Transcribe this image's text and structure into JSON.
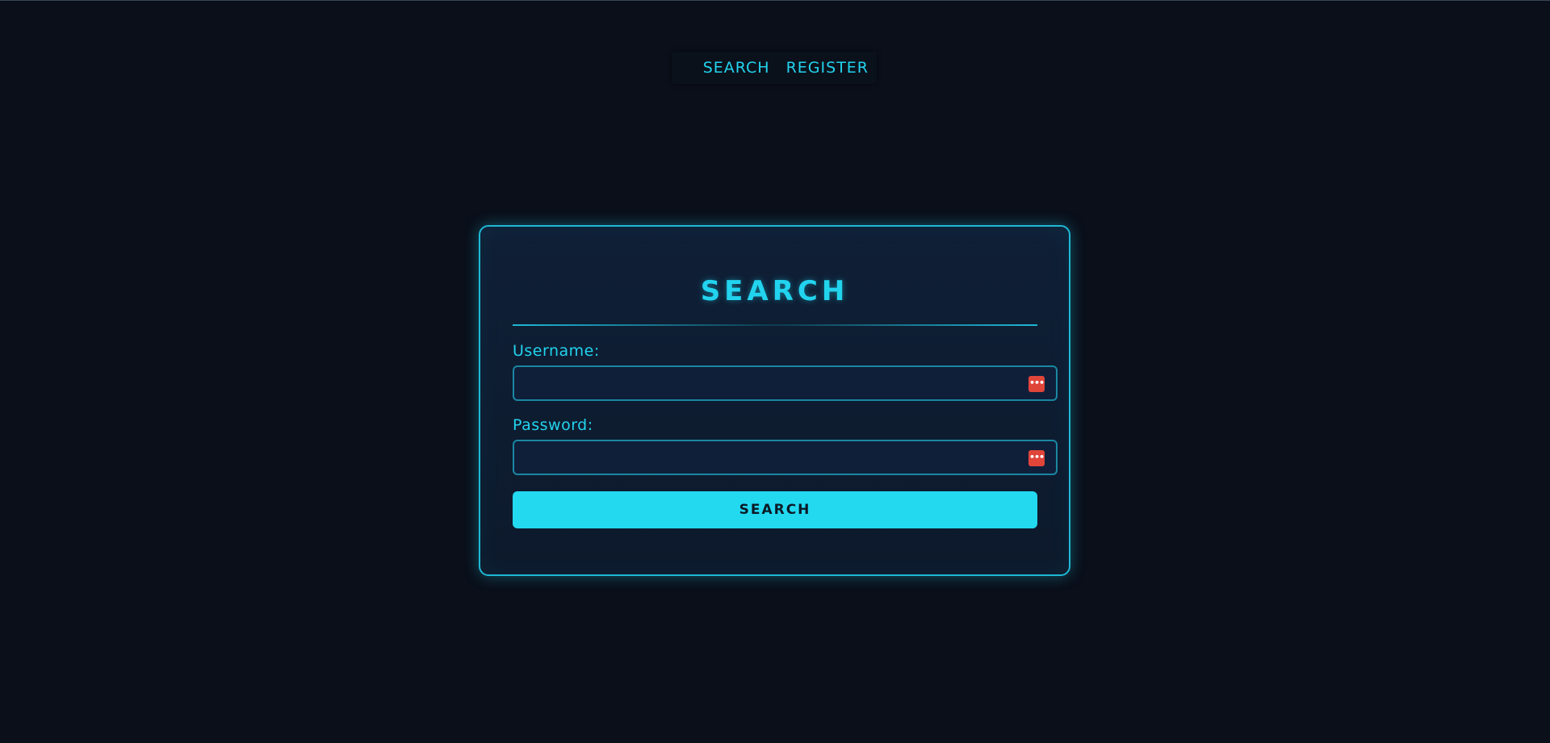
{
  "nav": {
    "items": [
      {
        "label": "SEARCH"
      },
      {
        "label": "REGISTER"
      }
    ]
  },
  "form": {
    "title": "SEARCH",
    "username_label": "Username:",
    "username_value": "",
    "password_label": "Password:",
    "password_value": "",
    "submit_label": "SEARCH",
    "password_manager_icon": "password-manager-icon"
  },
  "colors": {
    "background": "#0a0f1a",
    "accent": "#22d3ee",
    "card_border": "#1fb8d6",
    "button": "#22d9f0",
    "password_manager_icon": "#e0453a"
  }
}
